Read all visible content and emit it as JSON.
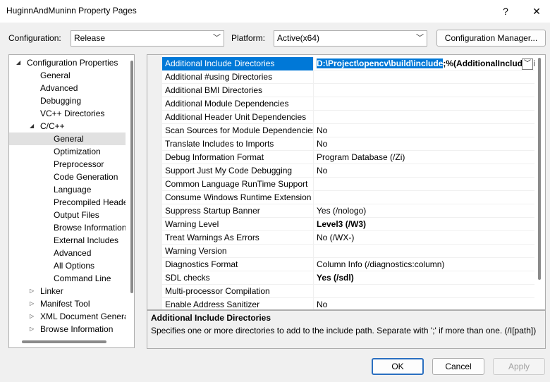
{
  "window": {
    "title": "HuginnAndMuninn Property Pages",
    "help": "?",
    "close": "✕"
  },
  "top": {
    "configuration_label": "Configuration:",
    "configuration_value": "Release",
    "platform_label": "Platform:",
    "platform_value": "Active(x64)",
    "configuration_manager": "Configuration Manager..."
  },
  "tree": {
    "items": [
      {
        "label": "Configuration Properties",
        "exp": "◢"
      },
      {
        "label": "General"
      },
      {
        "label": "Advanced"
      },
      {
        "label": "Debugging"
      },
      {
        "label": "VC++ Directories"
      },
      {
        "label": "C/C++",
        "exp": "◢"
      },
      {
        "label": "General"
      },
      {
        "label": "Optimization"
      },
      {
        "label": "Preprocessor"
      },
      {
        "label": "Code Generation"
      },
      {
        "label": "Language"
      },
      {
        "label": "Precompiled Heade"
      },
      {
        "label": "Output Files"
      },
      {
        "label": "Browse Information"
      },
      {
        "label": "External Includes"
      },
      {
        "label": "Advanced"
      },
      {
        "label": "All Options"
      },
      {
        "label": "Command Line"
      },
      {
        "label": "Linker",
        "exp": "▷"
      },
      {
        "label": "Manifest Tool",
        "exp": "▷"
      },
      {
        "label": "XML Document Genera",
        "exp": "▷"
      },
      {
        "label": "Browse Information",
        "exp": "▷"
      }
    ]
  },
  "grid": {
    "selected_value_highlight": "D:\\Project\\opencv\\build\\include",
    "selected_value_rest": ";%(AdditionalIncludeDirectories)",
    "dropdown": "﹀",
    "rows": [
      {
        "name": "Additional Include Directories",
        "value": ""
      },
      {
        "name": "Additional #using Directories",
        "value": ""
      },
      {
        "name": "Additional BMI Directories",
        "value": ""
      },
      {
        "name": "Additional Module Dependencies",
        "value": ""
      },
      {
        "name": "Additional Header Unit Dependencies",
        "value": ""
      },
      {
        "name": "Scan Sources for Module Dependencies",
        "value": "No"
      },
      {
        "name": "Translate Includes to Imports",
        "value": "No"
      },
      {
        "name": "Debug Information Format",
        "value": "Program Database (/Zi)"
      },
      {
        "name": "Support Just My Code Debugging",
        "value": "No"
      },
      {
        "name": "Common Language RunTime Support",
        "value": ""
      },
      {
        "name": "Consume Windows Runtime Extension",
        "value": ""
      },
      {
        "name": "Suppress Startup Banner",
        "value": "Yes (/nologo)"
      },
      {
        "name": "Warning Level",
        "value": "Level3 (/W3)"
      },
      {
        "name": "Treat Warnings As Errors",
        "value": "No (/WX-)"
      },
      {
        "name": "Warning Version",
        "value": ""
      },
      {
        "name": "Diagnostics Format",
        "value": "Column Info (/diagnostics:column)"
      },
      {
        "name": "SDL checks",
        "value": "Yes (/sdl)"
      },
      {
        "name": "Multi-processor Compilation",
        "value": ""
      },
      {
        "name": "Enable Address Sanitizer",
        "value": "No"
      }
    ]
  },
  "description": {
    "title": "Additional Include Directories",
    "text": "Specifies one or more directories to add to the include path. Separate with ';' if more than one. (/I[path])"
  },
  "buttons": {
    "ok": "OK",
    "cancel": "Cancel",
    "apply": "Apply"
  }
}
